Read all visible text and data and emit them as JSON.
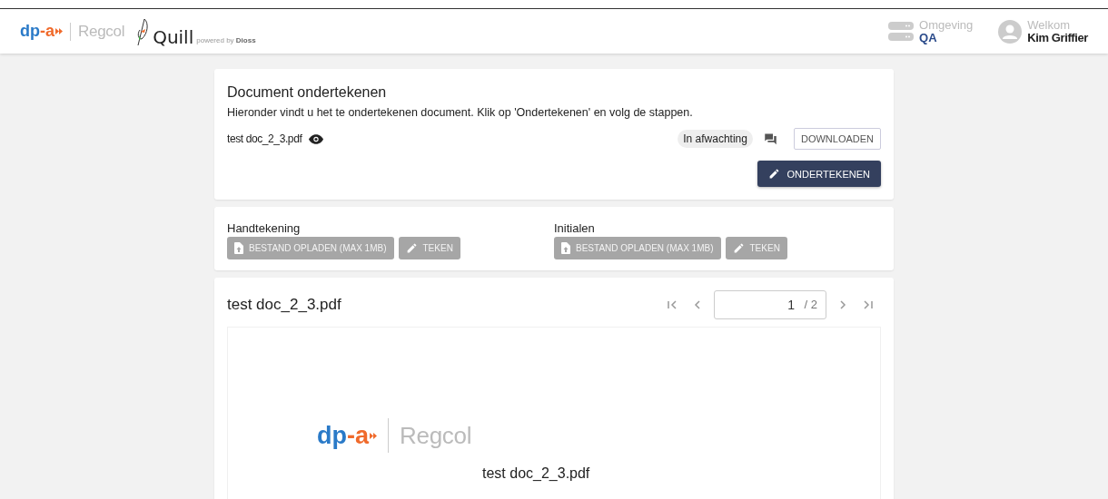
{
  "header": {
    "logo": {
      "dp": "dp",
      "a": "-a",
      "brand": "Regcol"
    },
    "quill": {
      "name": "Quill",
      "powered_by": "powered by",
      "company": "Dioss"
    },
    "environment": {
      "label": "Omgeving",
      "value": "QA"
    },
    "user": {
      "greeting": "Welkom",
      "name": "Kim Griffier"
    }
  },
  "sign_card": {
    "title": "Document ondertekenen",
    "description": "Hieronder vindt u het te ondertekenen document. Klik op 'Ondertekenen' en volg de stappen.",
    "file_name": "test doc_2_3.pdf",
    "status": "In afwachting",
    "download_button": "DOWNLOADEN",
    "sign_button": {
      "label": "ONDERTEKENEN",
      "disabled": false
    }
  },
  "signature_card": {
    "groups": [
      {
        "label": "Handtekening",
        "buttons": [
          {
            "kind": "upload",
            "label": "BESTAND OPLADEN (MAX 1MB)",
            "disabled": true
          },
          {
            "kind": "draw",
            "label": "TEKEN",
            "disabled": true
          }
        ]
      },
      {
        "label": "Initialen",
        "buttons": [
          {
            "kind": "upload",
            "label": "BESTAND OPLADEN (MAX 1MB)",
            "disabled": true
          },
          {
            "kind": "draw",
            "label": "TEKEN",
            "disabled": true
          }
        ]
      }
    ]
  },
  "viewer": {
    "title": "test doc_2_3.pdf",
    "page": "1",
    "page_total": "/ 2",
    "document": {
      "logo": {
        "dp": "dp",
        "a": "-a",
        "brand": "Regcol"
      },
      "title": "test doc_2_3.pdf"
    }
  }
}
